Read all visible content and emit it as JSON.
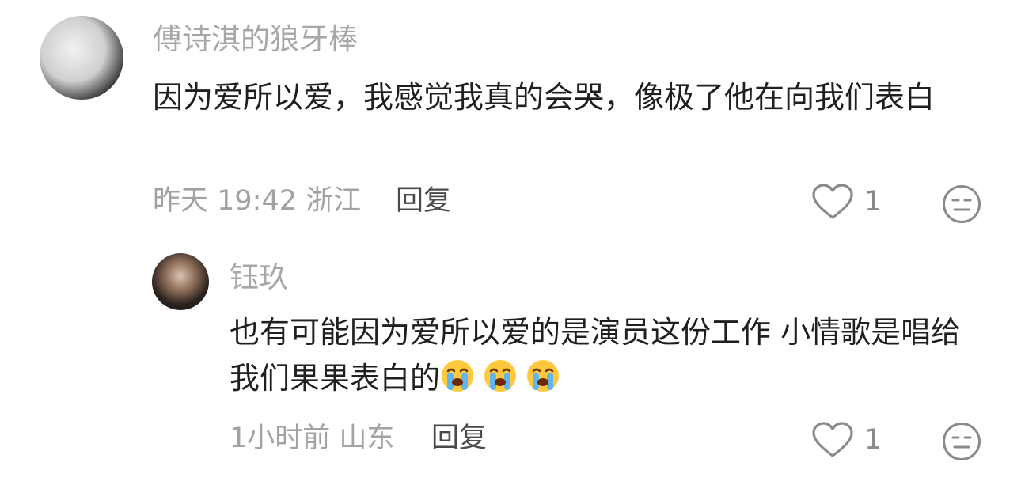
{
  "comments": [
    {
      "username": "傅诗淇的狼牙棒",
      "text": "因为爱所以爱，我感觉我真的会哭，像极了他在向我们表白",
      "time": "昨天 19:42",
      "location": "浙江",
      "reply_label": "回复",
      "likes": "1"
    },
    {
      "username": "钰玖",
      "text": "也有可能因为爱所以爱的是演员这份工作 小情歌是唱给我们果果表白的",
      "emojis": [
        "loudly-crying-face",
        "loudly-crying-face",
        "loudly-crying-face"
      ],
      "time": "1小时前",
      "location": "山东",
      "reply_label": "回复",
      "likes": "1"
    }
  ],
  "icons": {
    "like": "heart-outline-icon",
    "dislike": "unamused-face-icon"
  },
  "colors": {
    "username": "#a7a7a7",
    "text": "#1f1f1f",
    "meta": "#a2a2a2",
    "reply": "#4a4a4a",
    "icon": "#8a8a8a"
  }
}
